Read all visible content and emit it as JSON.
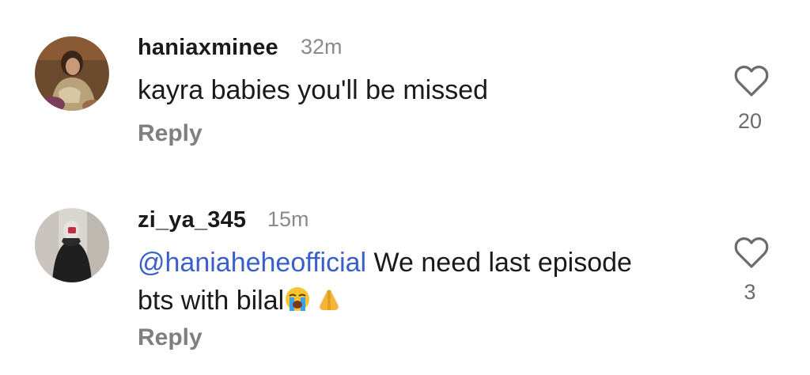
{
  "comments": [
    {
      "username": "haniaxminee",
      "time": "32m",
      "text": "kayra babies you'll be missed",
      "reply_label": "Reply",
      "likes": "20",
      "avatar": "profile-photo"
    },
    {
      "username": "zi_ya_345",
      "time": "15m",
      "mention": "@haniaheheofficial",
      "text_line1": " We need last episode",
      "text_line2": "bts with bilal",
      "emojis": [
        "loudly-crying-face",
        "folded-hands"
      ],
      "reply_label": "Reply",
      "likes": "3",
      "avatar": "profile-photo"
    }
  ],
  "colors": {
    "mention": "#3a5fcd",
    "muted": "#8a8a8a",
    "text": "#1a1a1a"
  },
  "icons": [
    "heart-icon"
  ]
}
